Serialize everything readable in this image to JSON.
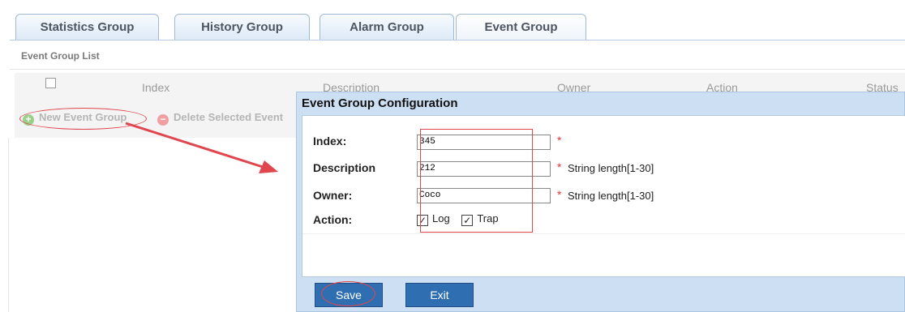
{
  "tabs": [
    {
      "label": "Statistics Group"
    },
    {
      "label": "History Group"
    },
    {
      "label": "Alarm Group"
    },
    {
      "label": "Event Group"
    }
  ],
  "list": {
    "title": "Event Group List",
    "columns": [
      "Index",
      "Description",
      "Owner",
      "Action",
      "Status"
    ],
    "new_button": "New Event Group",
    "delete_button": "Delete Selected Event"
  },
  "dialog": {
    "title": "Event Group Configuration",
    "fields": {
      "index": {
        "label": "Index:",
        "value": "345"
      },
      "description": {
        "label": "Description",
        "value": "212",
        "hint": "String length[1-30]"
      },
      "owner": {
        "label": "Owner:",
        "value": "Coco",
        "hint": "String length[1-30]"
      }
    },
    "action": {
      "label": "Action:",
      "log": "Log",
      "trap": "Trap",
      "log_checked": true,
      "trap_checked": true
    },
    "required_mark": "*",
    "save_label": "Save",
    "exit_label": "Exit"
  },
  "colors": {
    "accent_blue": "#2f6fb1",
    "annotation_red": "#e0464e",
    "dialog_bg": "#cde0f3"
  },
  "icons": {
    "add": "plus-circle-icon",
    "delete": "minus-circle-icon",
    "check": "check-icon"
  }
}
